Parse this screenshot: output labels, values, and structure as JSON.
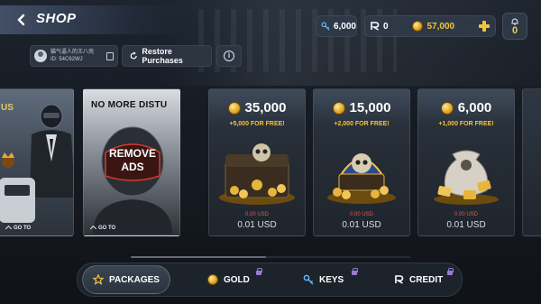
{
  "header": {
    "title": "SHOP",
    "keys_count": "6,000",
    "r_credit": "0",
    "gold_count": "57,000",
    "notification_count": "0"
  },
  "user": {
    "name": "猫气逼人的王八壳",
    "id": "ID: 54C62WJ"
  },
  "actions": {
    "restore_label": "Restore Purchases"
  },
  "cards": {
    "promo1": {
      "title": "US",
      "goto": "GO TO"
    },
    "promo2": {
      "title": "NO MORE DISTU",
      "badge": "REMOVE ADS",
      "goto": "GO TO"
    },
    "gold": [
      {
        "amount": "35,000",
        "bonus": "+5,000 FOR FREE!",
        "old_price": "0.00 USD",
        "price": "0.01 USD"
      },
      {
        "amount": "15,000",
        "bonus": "+2,000 FOR FREE!",
        "old_price": "0.00 USD",
        "price": "0.01 USD"
      },
      {
        "amount": "6,000",
        "bonus": "+1,000 FOR FREE!",
        "old_price": "0.00 USD",
        "price": "0.01 USD"
      }
    ]
  },
  "tabs": {
    "packages": "PACKAGES",
    "gold": "GOLD",
    "keys": "KEYS",
    "credit": "CREDIT"
  },
  "colors": {
    "accent_gold": "#f3c43a",
    "old_price_red": "#e05a4e"
  }
}
